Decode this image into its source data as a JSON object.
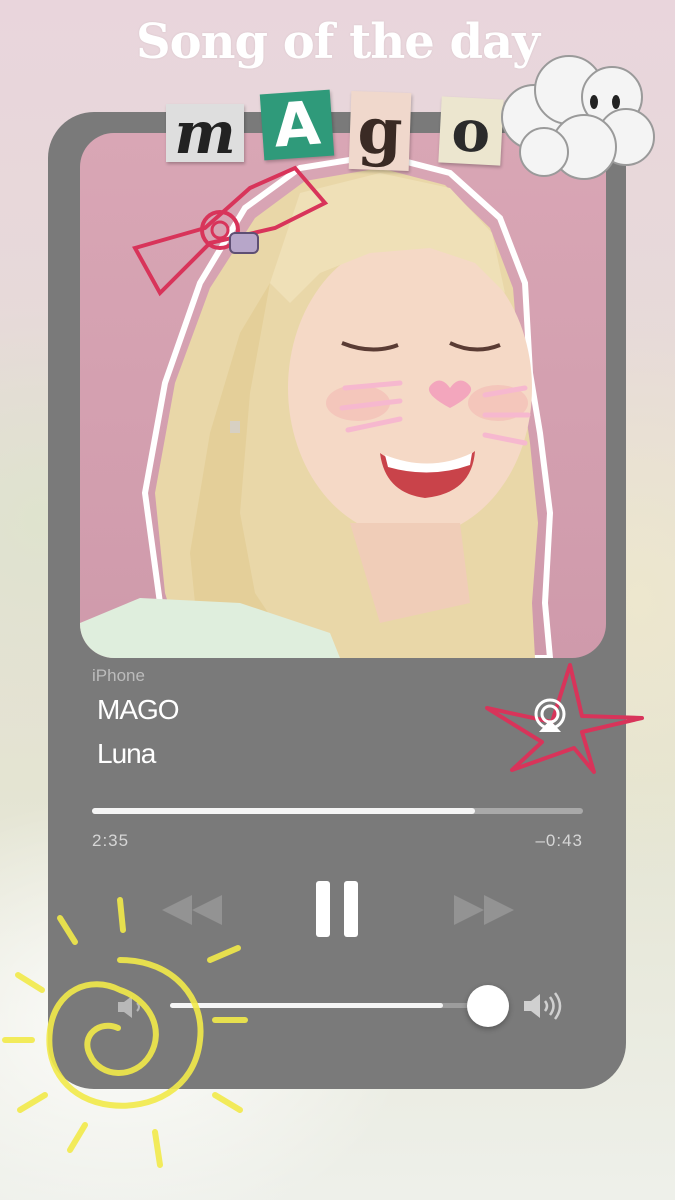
{
  "header": {
    "title": "Song of the day",
    "letters": [
      "m",
      "A",
      "g",
      "o"
    ]
  },
  "player": {
    "source": "iPhone",
    "song_title": "MAGO",
    "artist": "Luna",
    "elapsed": "2:35",
    "remaining": "–0:43",
    "progress": 0.78,
    "volume": 0.86,
    "state": "playing"
  },
  "icons": {
    "rewind": "rewind-icon",
    "pause": "pause-icon",
    "fast_forward": "fast-forward-icon",
    "airplay": "airplay-icon",
    "volume_low": "volume-low-icon",
    "volume_high": "volume-high-icon"
  },
  "colors": {
    "card": "#7a7a7a",
    "photo_bg": "#d9a6b5",
    "doodle_red": "#d8345a",
    "doodle_yellow": "#f2ea4a"
  }
}
